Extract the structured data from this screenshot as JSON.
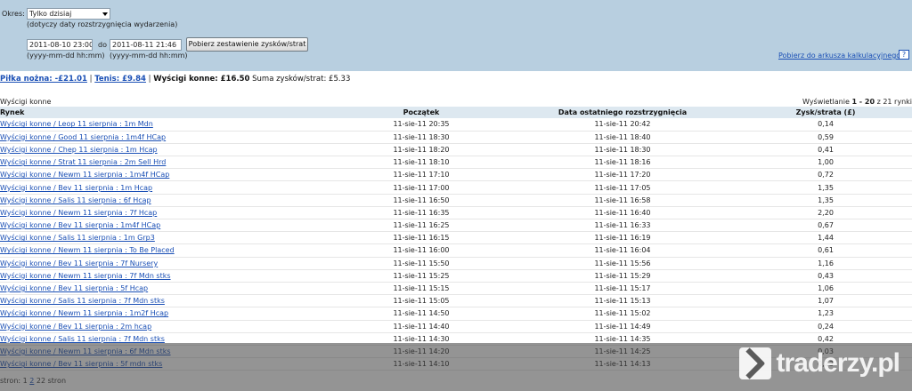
{
  "filter": {
    "period_label": "Okres:",
    "period_value": "Tylko dzisiaj",
    "period_note": "(dotyczy daty rozstrzygnięcia wydarzenia)",
    "date_from": "2011-08-10 23:00",
    "to_label": "do",
    "date_to": "2011-08-11 21:46",
    "format_from": "(yyyy-mm-dd hh:mm)",
    "format_to": "(yyyy-mm-dd hh:mm)",
    "submit_label": "Pobierz zestawienie zysków/strat",
    "export_link": "Pobierz do arkusza kalkulacyjnego",
    "help_label": "?"
  },
  "summary": {
    "football": "Piłka nożna: -£21.01",
    "sep1": "|",
    "tennis": "Tenis: £9.84",
    "sep2": "|",
    "racing": "Wyścigi konne: £16.50",
    "total_label": "Suma zysków/strat:",
    "total_value": "£5.33"
  },
  "section": {
    "title": "Wyścigi konne",
    "showing_prefix": "Wyświetlanie",
    "showing_range": "1 - 20",
    "showing_suffix": "z 21 rynki"
  },
  "table": {
    "headers": {
      "market": "Rynek",
      "start": "Początek",
      "settled": "Data ostatniego rozstrzygnięcia",
      "pl": "Zysk/strata (£)"
    },
    "rows": [
      {
        "market": "Wyścigi konne / Leop 11 sierpnia : 1m Mdn",
        "start": "11-sie-11 20:35",
        "settled": "11-sie-11 20:42",
        "pl": "0,14"
      },
      {
        "market": "Wyścigi konne / Good 11 sierpnia : 1m4f HCap",
        "start": "11-sie-11 18:30",
        "settled": "11-sie-11 18:40",
        "pl": "0,59"
      },
      {
        "market": "Wyścigi konne / Chep 11 sierpnia : 1m Hcap",
        "start": "11-sie-11 18:20",
        "settled": "11-sie-11 18:30",
        "pl": "0,41"
      },
      {
        "market": "Wyścigi konne / Strat 11 sierpnia : 2m Sell Hrd",
        "start": "11-sie-11 18:10",
        "settled": "11-sie-11 18:16",
        "pl": "1,00"
      },
      {
        "market": "Wyścigi konne / Newm 11 sierpnia : 1m4f HCap",
        "start": "11-sie-11 17:10",
        "settled": "11-sie-11 17:20",
        "pl": "0,72"
      },
      {
        "market": "Wyścigi konne / Bev 11 sierpnia : 1m Hcap",
        "start": "11-sie-11 17:00",
        "settled": "11-sie-11 17:05",
        "pl": "1,35"
      },
      {
        "market": "Wyścigi konne / Salis 11 sierpnia : 6f Hcap",
        "start": "11-sie-11 16:50",
        "settled": "11-sie-11 16:58",
        "pl": "1,35"
      },
      {
        "market": "Wyścigi konne / Newm 11 sierpnia : 7f Hcap",
        "start": "11-sie-11 16:35",
        "settled": "11-sie-11 16:40",
        "pl": "2,20"
      },
      {
        "market": "Wyścigi konne / Bev 11 sierpnia : 1m4f HCap",
        "start": "11-sie-11 16:25",
        "settled": "11-sie-11 16:33",
        "pl": "0,67"
      },
      {
        "market": "Wyścigi konne / Salis 11 sierpnia : 1m Grp3",
        "start": "11-sie-11 16:15",
        "settled": "11-sie-11 16:19",
        "pl": "1,44"
      },
      {
        "market": "Wyścigi konne / Newm 11 sierpnia : To Be Placed",
        "start": "11-sie-11 16:00",
        "settled": "11-sie-11 16:04",
        "pl": "0,61"
      },
      {
        "market": "Wyścigi konne / Bev 11 sierpnia : 7f Nursery",
        "start": "11-sie-11 15:50",
        "settled": "11-sie-11 15:56",
        "pl": "1,16"
      },
      {
        "market": "Wyścigi konne / Newm 11 sierpnia : 7f Mdn stks",
        "start": "11-sie-11 15:25",
        "settled": "11-sie-11 15:29",
        "pl": "0,43"
      },
      {
        "market": "Wyścigi konne / Bev 11 sierpnia : 5f Hcap",
        "start": "11-sie-11 15:15",
        "settled": "11-sie-11 15:17",
        "pl": "1,06"
      },
      {
        "market": "Wyścigi konne / Salis 11 sierpnia : 7f Mdn stks",
        "start": "11-sie-11 15:05",
        "settled": "11-sie-11 15:13",
        "pl": "1,07"
      },
      {
        "market": "Wyścigi konne / Newm 11 sierpnia : 1m2f Hcap",
        "start": "11-sie-11 14:50",
        "settled": "11-sie-11 15:02",
        "pl": "1,23"
      },
      {
        "market": "Wyścigi konne / Bev 11 sierpnia : 2m hcap",
        "start": "11-sie-11 14:40",
        "settled": "11-sie-11 14:49",
        "pl": "0,24"
      },
      {
        "market": "Wyścigi konne / Salis 11 sierpnia : 7f Mdn stks",
        "start": "11-sie-11 14:30",
        "settled": "11-sie-11 14:35",
        "pl": "0,42"
      },
      {
        "market": "Wyścigi konne / Newm 11 sierpnia : 6f Mdn stks",
        "start": "11-sie-11 14:20",
        "settled": "11-sie-11 14:25",
        "pl": "0,03"
      },
      {
        "market": "Wyścigi konne / Bev 11 sierpnia : 5f mdn stks",
        "start": "11-sie-11 14:10",
        "settled": "11-sie-11 14:13",
        "pl": "0,23"
      }
    ]
  },
  "pager": {
    "prefix": "stron:",
    "page1": "1",
    "page2": "2",
    "suffix": "22 stron"
  },
  "watermark": {
    "text": "traderzy.pl"
  }
}
